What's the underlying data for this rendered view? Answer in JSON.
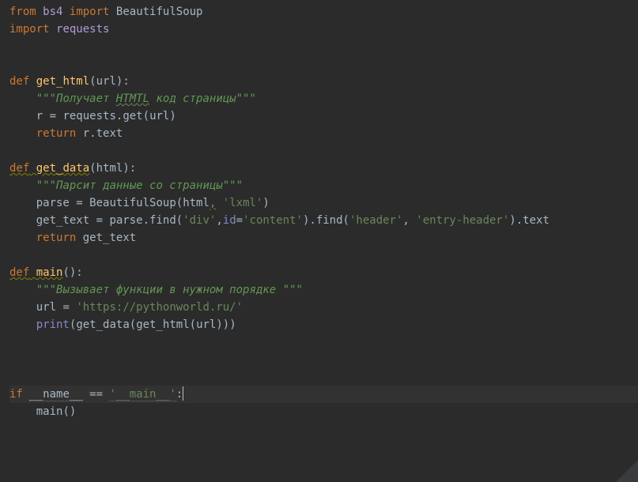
{
  "code": {
    "l1": {
      "from": "from",
      "mod1": "bs4",
      "import": "import",
      "sym": "BeautifulSoup"
    },
    "l2": {
      "import": "import",
      "mod": "requests"
    },
    "l5": {
      "def": "def",
      "name": "get_html",
      "lp": "(",
      "p1": "url",
      "rp": "):"
    },
    "l6": {
      "ind": "    ",
      "q1": "\"\"\"",
      "txt": "Получает ",
      "spell": "HTMTL",
      "txt2": " код страницы",
      "q2": "\"\"\""
    },
    "l7": {
      "ind": "    ",
      "lhs": "r",
      "eq": " = ",
      "obj": "requests",
      "dot": ".",
      "m": "get",
      "lp": "(",
      "a1": "url",
      "rp": ")"
    },
    "l8": {
      "ind": "    ",
      "ret": "return",
      "sp": " ",
      "obj": "r",
      "dot": ".",
      "attr": "text"
    },
    "l10": {
      "def": "def",
      "sp": " ",
      "name": "get_data",
      "lp": "(",
      "p1": "html",
      "rp": "):"
    },
    "l11": {
      "ind": "    ",
      "q1": "\"\"\"",
      "txt": "Парсит данные со страницы",
      "q2": "\"\"\""
    },
    "l12": {
      "ind": "    ",
      "lhs": "parse",
      "eq": " = ",
      "cls": "BeautifulSoup",
      "lp": "(",
      "a1": "html",
      "hint": ",",
      "sep": " ",
      "s1": "'lxml'",
      "rp": ")"
    },
    "l13": {
      "ind": "    ",
      "lhs": "get_text",
      "eq": " = ",
      "obj": "parse",
      "dot1": ".",
      "m1": "find",
      "lp1": "(",
      "s1": "'div'",
      "c1": ",",
      "kw1hint": "",
      "kw1": "id",
      "eq2": "=",
      "s2": "'content'",
      "rp1": ")",
      "dot2": ".",
      "m2": "find",
      "lp2": "(",
      "s3": "'header'",
      "c2": ", ",
      "s4": "'entry-header'",
      "rp2": ")",
      "dot3": ".",
      "attr": "text"
    },
    "l14": {
      "ind": "    ",
      "ret": "return",
      "sp": " ",
      "v": "get_text"
    },
    "l16": {
      "def": "def",
      "sp": " ",
      "name": "main",
      "parens": "():"
    },
    "l17": {
      "ind": "    ",
      "q1": "\"\"\"",
      "txt": "Вызывает функции в нужном порядке ",
      "q2": "\"\"\""
    },
    "l18": {
      "ind": "    ",
      "lhs": "url",
      "eq": " = ",
      "s": "'https://pythonworld.ru/'"
    },
    "l19": {
      "ind": "    ",
      "fn": "print",
      "lp": "(",
      "f1": "get_data",
      "lp2": "(",
      "f2": "get_html",
      "lp3": "(",
      "a": "url",
      "rp3": ")",
      "rp2": ")",
      "rp": ")"
    },
    "l23": {
      "if": "if",
      "sp1": " ",
      "name": "__name__",
      "sp2": " ",
      "eq": "==",
      "sp3": " ",
      "s": "'__main__'",
      "colon": ":"
    },
    "l24": {
      "ind": "    ",
      "fn": "main",
      "parens": "()"
    }
  }
}
